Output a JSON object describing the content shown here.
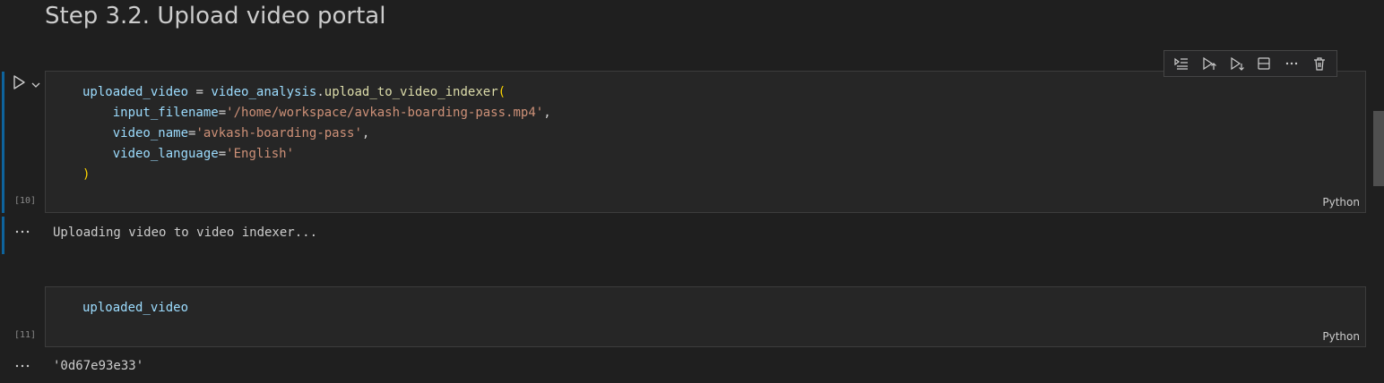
{
  "heading": "Step 3.2. Upload video portal",
  "toolbar": {
    "icons": [
      "execute-above-cells-icon",
      "execute-cell-and-below-icon",
      "run-below-icon",
      "split-cell-icon",
      "more-actions-icon",
      "delete-cell-icon"
    ]
  },
  "cells": [
    {
      "execution_count": "[10]",
      "language": "Python",
      "code": {
        "line1": {
          "var": "uploaded_video",
          "op": " = ",
          "obj": "video_analysis",
          "dot": ".",
          "fn": "upload_to_video_indexer",
          "paren": "("
        },
        "line2": {
          "param": "input_filename",
          "eq": "=",
          "str": "'/home/workspace/avkash-boarding-pass.mp4'",
          "comma": ","
        },
        "line3": {
          "param": "video_name",
          "eq": "=",
          "str": "'avkash-boarding-pass'",
          "comma": ","
        },
        "line4": {
          "param": "video_language",
          "eq": "=",
          "str": "'English'"
        },
        "line5": {
          "paren": ")"
        }
      },
      "output": "Uploading video to video indexer..."
    },
    {
      "execution_count": "[11]",
      "language": "Python",
      "code": {
        "line1": "uploaded_video"
      },
      "output": "'0d67e93e33'"
    }
  ],
  "colors": {
    "background": "#1f1f1f",
    "cell_background": "#262626",
    "accent_bar": "#0e639c",
    "variable": "#9cdcfe",
    "function": "#dcdcaa",
    "string": "#ce9178",
    "bracket": "#ffd700"
  },
  "icons": {
    "run": "run-cell-icon",
    "expand": "chevron-down-icon",
    "output_menu": "ellipsis-icon"
  }
}
